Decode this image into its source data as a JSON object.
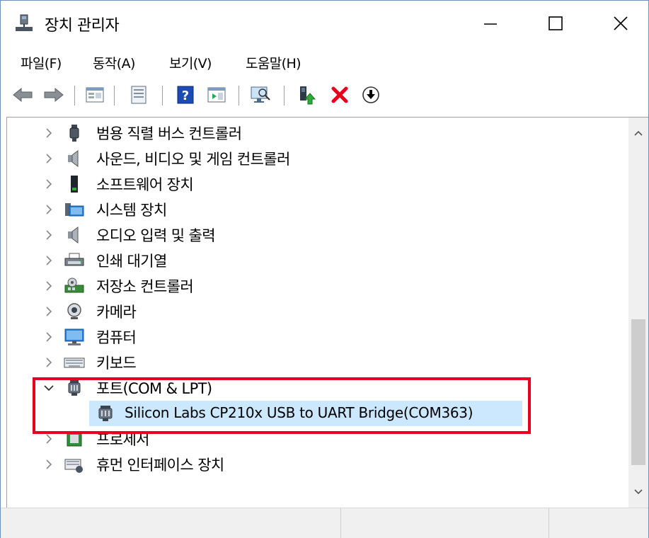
{
  "window": {
    "title": "장치 관리자",
    "icon": "device-manager-icon"
  },
  "menu": [
    "파일(F)",
    "동작(A)",
    "보기(V)",
    "도움말(H)"
  ],
  "toolbar": {
    "icons": [
      "back-icon",
      "forward-icon",
      "properties-list-icon",
      "refresh-icon",
      "help-icon",
      "action-pane-icon",
      "scan-hardware-icon",
      "update-driver-icon",
      "uninstall-icon",
      "download-icon"
    ],
    "colors": {
      "uninstall": "#e8001c",
      "help": "#1c4bb7"
    }
  },
  "tree": {
    "items": [
      {
        "label": "범용 직렬 버스 컨트롤러",
        "icon": "usb-controller-icon",
        "expanded": false
      },
      {
        "label": "사운드, 비디오 및 게임 컨트롤러",
        "icon": "speaker-icon",
        "expanded": false
      },
      {
        "label": "소프트웨어 장치",
        "icon": "software-device-icon",
        "expanded": false
      },
      {
        "label": "시스템 장치",
        "icon": "system-device-icon",
        "expanded": false
      },
      {
        "label": "오디오 입력 및 출력",
        "icon": "speaker-icon",
        "expanded": false
      },
      {
        "label": "인쇄 대기열",
        "icon": "printer-icon",
        "expanded": false
      },
      {
        "label": "저장소 컨트롤러",
        "icon": "storage-controller-icon",
        "expanded": false
      },
      {
        "label": "카메라",
        "icon": "camera-icon",
        "expanded": false
      },
      {
        "label": "컴퓨터",
        "icon": "computer-icon",
        "expanded": false
      },
      {
        "label": "키보드",
        "icon": "keyboard-icon",
        "expanded": false
      },
      {
        "label": "포트(COM & LPT)",
        "icon": "port-icon",
        "expanded": true
      },
      {
        "label": "프로세서",
        "icon": "processor-icon",
        "expanded": false
      },
      {
        "label": "휴먼 인터페이스 장치",
        "icon": "hid-icon",
        "expanded": false
      }
    ],
    "selected_child": {
      "label": "Silicon Labs CP210x USB to UART Bridge(COM363)",
      "icon": "port-icon"
    }
  },
  "colors": {
    "selection": "#cce8ff",
    "highlight_box": "#e8001c"
  }
}
